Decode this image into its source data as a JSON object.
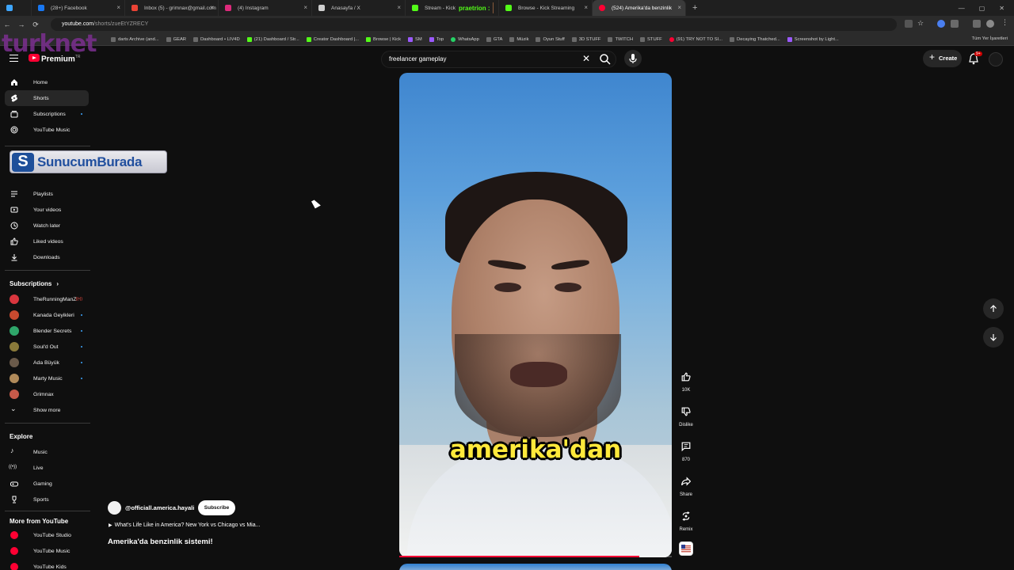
{
  "browser": {
    "tabs": [
      {
        "title": "",
        "color": "#3ea6ff"
      },
      {
        "title": "(28+) Facebook",
        "color": "#1877f2"
      },
      {
        "title": "Inbox (5) - grimnax@gmail.com",
        "color": "#ea4335"
      },
      {
        "title": "(4) Instagram",
        "color": "#dd2a7b"
      },
      {
        "title": "Anasayfa / X",
        "color": "#cfcfcf"
      },
      {
        "title": "Stream - Kick",
        "overlay": "praetrion :",
        "color": "#53fc18"
      },
      {
        "title": "Browse - Kick Streaming",
        "color": "#53fc18"
      },
      {
        "title": "(524) Amerika'da benzinlik",
        "color": "#ff0033"
      }
    ],
    "url_host": "youtube.com",
    "url_path": "/shorts/zueEtYZRECY",
    "bookmarks_left": "…",
    "bookmarks": [
      "darts Archive (and...",
      "GEAR",
      "Dashboard • LIV4D",
      "(21) Dashboard / Str...",
      "Creator Dashboard |...",
      "Browse | Kick",
      "SM",
      "Top",
      "WhatsApp",
      "GTA",
      "Müzik",
      "Oyun Stuff",
      "3D STUFF",
      "TWITCH",
      "STUFF",
      "(91) TRY NOT TO SI...",
      "Decaying Thatched...",
      "Screenshot by Light..."
    ],
    "bookmarks_right": "Tüm Yer İşaretleri"
  },
  "watermark": "turknet",
  "header": {
    "logo_text": "Premium",
    "logo_region": "TR",
    "search_value": "freelancer gameplay",
    "create_label": "Create",
    "notif_count": "9+"
  },
  "sidebar": {
    "main": [
      {
        "label": "Home",
        "icon": "home-icon",
        "active": false
      },
      {
        "label": "Shorts",
        "icon": "shorts-icon",
        "active": true
      },
      {
        "label": "Subscriptions",
        "icon": "subscriptions-icon",
        "active": false
      },
      {
        "label": "YouTube Music",
        "icon": "music-icon",
        "active": false
      }
    ],
    "you": [
      {
        "label": "Playlists",
        "icon": "playlists-icon"
      },
      {
        "label": "Your videos",
        "icon": "your-videos-icon"
      },
      {
        "label": "Watch later",
        "icon": "clock-icon"
      },
      {
        "label": "Liked videos",
        "icon": "thumbs-up-icon"
      },
      {
        "label": "Downloads",
        "icon": "download-icon"
      }
    ],
    "subscriptions_heading": "Subscriptions",
    "subscriptions": [
      {
        "label": "TheRunningManZ",
        "color": "#d9363e",
        "badge": "live"
      },
      {
        "label": "Kanada Geyikleri",
        "color": "#c94a2f",
        "badge": "dot"
      },
      {
        "label": "Blender Secrets",
        "color": "#2fa66a",
        "badge": "dot"
      },
      {
        "label": "Soul'd Out",
        "color": "#8a7a3a",
        "badge": "dot"
      },
      {
        "label": "Ada Büyük",
        "color": "#6a5a4a",
        "badge": "dot"
      },
      {
        "label": "Marty Music",
        "color": "#b08a5a",
        "badge": "dot"
      },
      {
        "label": "Grimnax",
        "color": "#c65a4a",
        "badge": ""
      }
    ],
    "show_more": "Show more",
    "explore_heading": "Explore",
    "explore": [
      {
        "label": "Music",
        "icon": "music-note-icon"
      },
      {
        "label": "Live",
        "icon": "live-icon"
      },
      {
        "label": "Gaming",
        "icon": "gaming-icon"
      },
      {
        "label": "Sports",
        "icon": "trophy-icon"
      }
    ],
    "more_heading": "More from YouTube",
    "more": [
      {
        "label": "YouTube Studio"
      },
      {
        "label": "YouTube Music"
      },
      {
        "label": "YouTube Kids"
      }
    ]
  },
  "overlay_banner": {
    "logo_letter": "S",
    "text": "SunucumBurada"
  },
  "short": {
    "caption": "amerika'dan",
    "channel_handle": "@officiall.america.hayali",
    "subscribe_label": "Subscribe",
    "linked_video": "What's Life Like in America? New York vs Chicago vs Mia...",
    "title": "Amerika'da benzinlik sistemi!",
    "progress": 0.88
  },
  "actions": [
    {
      "name": "like",
      "label": "10K",
      "icon": "thumbs-up-icon"
    },
    {
      "name": "dislike",
      "label": "Dislike",
      "icon": "thumbs-down-icon"
    },
    {
      "name": "comments",
      "label": "870",
      "icon": "comment-icon"
    },
    {
      "name": "share",
      "label": "Share",
      "icon": "share-icon"
    },
    {
      "name": "remix",
      "label": "Remix",
      "icon": "remix-icon"
    }
  ]
}
